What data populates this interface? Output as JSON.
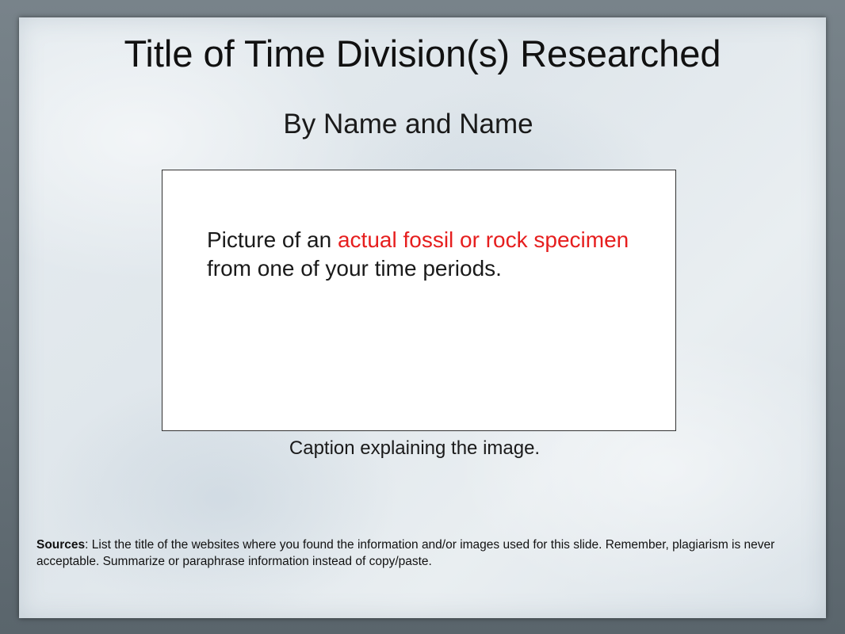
{
  "slide": {
    "title": "Title of Time Division(s) Researched",
    "subtitle": "By Name and Name",
    "image_placeholder": {
      "text_before": "Picture of an ",
      "text_highlight": "actual fossil or rock specimen",
      "text_after": " from one of your time periods.",
      "highlight_color": "#e61e1e"
    },
    "caption": "Caption explaining the image.",
    "sources": {
      "label": "Sources",
      "text": ": List the title of the websites where you found the information and/or images used for this slide.  Remember, plagiarism is never acceptable. Summarize or paraphrase information instead of copy/paste."
    }
  }
}
